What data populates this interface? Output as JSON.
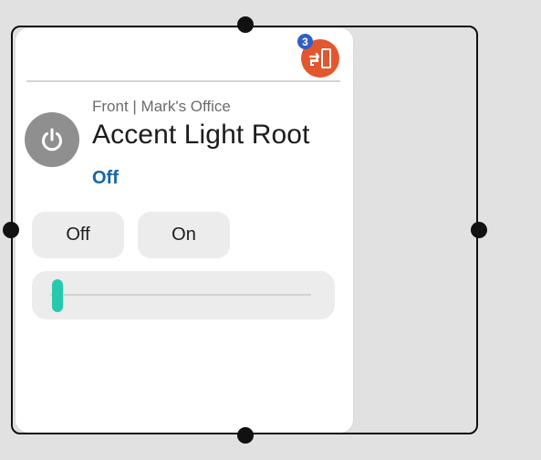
{
  "tile": {
    "location": "Front | Mark's Office",
    "device_name": "Accent Light Root",
    "status": "Off",
    "badge_count": "3",
    "buttons": {
      "off_label": "Off",
      "on_label": "On"
    },
    "level_slider": {
      "value_fraction": 0.0
    }
  },
  "icons": {
    "power": "power-icon",
    "exit": "exit-door-icon"
  },
  "colors": {
    "status_text": "#1467a8",
    "exit_button": "#e2572f",
    "badge": "#2f5fc4",
    "slider_thumb": "#26c9ad",
    "power_button": "#8f8f8f"
  }
}
